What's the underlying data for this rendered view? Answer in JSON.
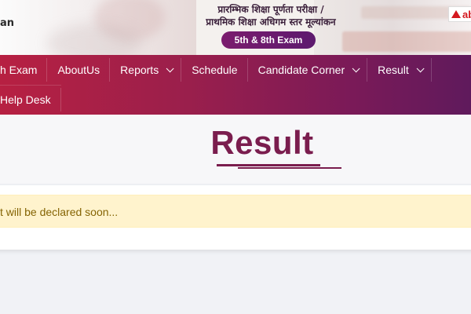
{
  "header": {
    "org_fragment": "an",
    "hindi_line1": "प्रारम्भिक शिक्षा पूर्णता परीक्षा /",
    "hindi_line2": "प्राथमिक शिक्षा अधिगम स्तर मूल्यांकन",
    "exam_pill": "5th & 8th Exam",
    "logo_text": "ab"
  },
  "nav": {
    "row1": [
      {
        "label": "h Exam",
        "dropdown": false
      },
      {
        "label": "AboutUs",
        "dropdown": false
      },
      {
        "label": "Reports",
        "dropdown": true
      },
      {
        "label": "Schedule",
        "dropdown": false
      },
      {
        "label": "Candidate Corner",
        "dropdown": true
      },
      {
        "label": "Result",
        "dropdown": true
      }
    ],
    "row2": [
      {
        "label": "Help Desk",
        "dropdown": false
      }
    ]
  },
  "main": {
    "title": "Result",
    "notice": "t will be declared soon..."
  },
  "colors": {
    "nav_start": "#b72042",
    "nav_end": "#5f1a5c",
    "title": "#7a1d4e",
    "notice_bg": "#fff3cd",
    "notice_text": "#856404"
  }
}
